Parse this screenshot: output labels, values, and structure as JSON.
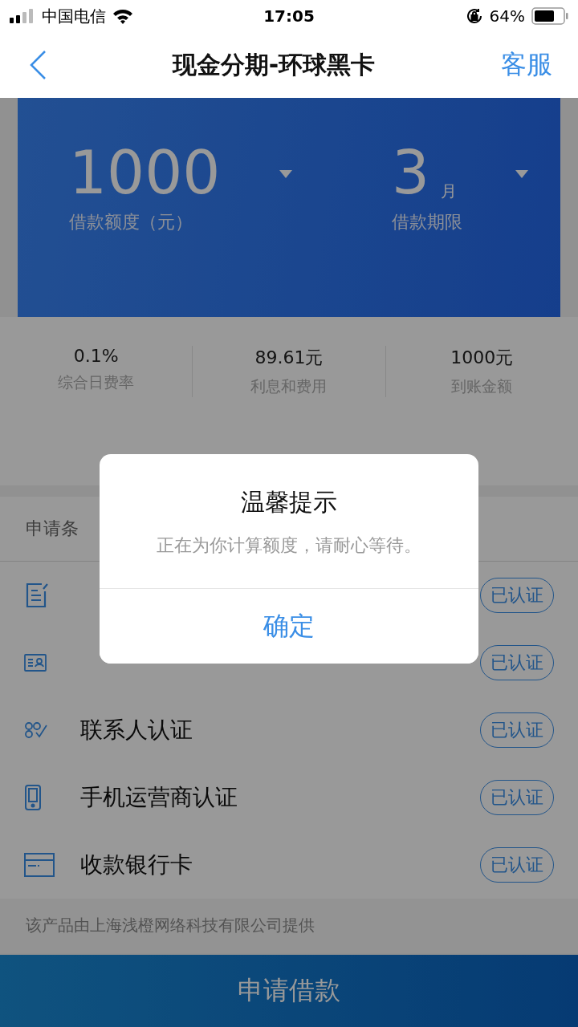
{
  "status_bar": {
    "carrier": "中国电信",
    "time": "17:05",
    "battery": "64%"
  },
  "nav": {
    "title": "现金分期-环球黑卡",
    "action": "客服"
  },
  "loan": {
    "amount": "1000",
    "amount_label": "借款额度（元）",
    "term": "3",
    "term_unit": "月",
    "term_label": "借款期限"
  },
  "stats": [
    {
      "value": "0.1%",
      "label": "综合日费率"
    },
    {
      "value": "89.61元",
      "label": "利息和费用"
    },
    {
      "value": "1000元",
      "label": "到账金额"
    }
  ],
  "conditions": {
    "heading": "申请条",
    "items": [
      {
        "kind": "form",
        "badge": "已认证"
      },
      {
        "kind": "id",
        "badge": "已认证"
      },
      {
        "kind": "contacts",
        "label": "联系人认证",
        "badge": "已认证"
      },
      {
        "kind": "phone",
        "label": "手机运营商认证",
        "badge": "已认证"
      },
      {
        "kind": "card",
        "label": "收款银行卡",
        "badge": "已认证"
      }
    ]
  },
  "footer_note": "该产品由上海浅橙网络科技有限公司提供",
  "submit": "申请借款",
  "dialog": {
    "title": "温馨提示",
    "message": "正在为你计算额度，请耐心等待。",
    "button": "确定"
  }
}
